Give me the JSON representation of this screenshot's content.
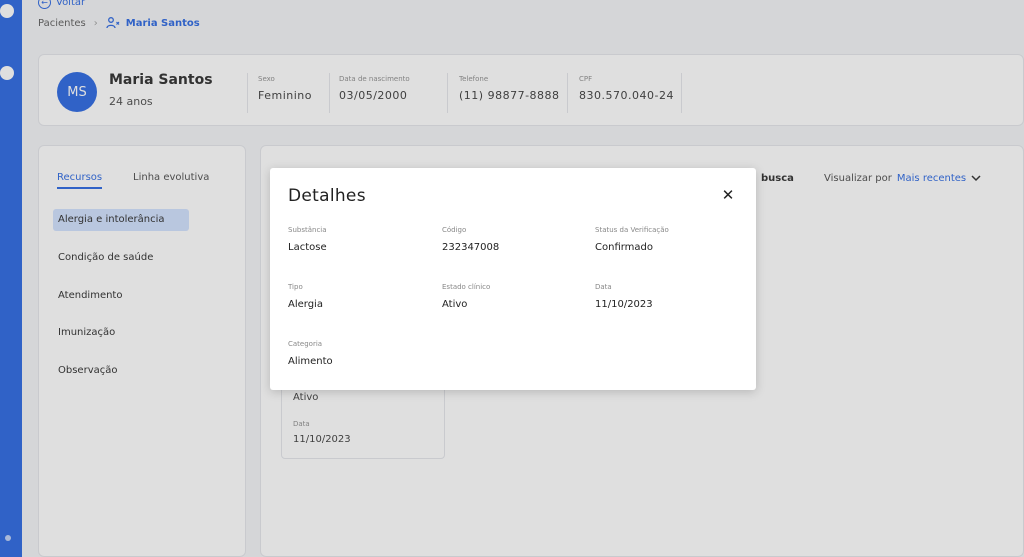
{
  "topbar": {
    "back_label": "Voltar",
    "breadcrumb_root": "Pacientes",
    "breadcrumb_sep": "›",
    "breadcrumb_current": "Maria Santos"
  },
  "patient": {
    "initials": "MS",
    "name": "Maria Santos",
    "age": "24 anos",
    "fields": [
      {
        "label": "Sexo",
        "value": "Feminino"
      },
      {
        "label": "Data de nascimento",
        "value": "03/05/2000"
      },
      {
        "label": "Telefone",
        "value": "(11) 98877-8888"
      },
      {
        "label": "CPF",
        "value": "830.570.040-24"
      }
    ]
  },
  "sidebar": {
    "tabs": [
      {
        "label": "Recursos"
      },
      {
        "label": "Linha evolutiva"
      }
    ],
    "items": [
      {
        "label": "Alergia e intolerância"
      },
      {
        "label": "Condição de saúde"
      },
      {
        "label": "Atendimento"
      },
      {
        "label": "Imunização"
      },
      {
        "label": "Observação"
      }
    ]
  },
  "main": {
    "search_hint": "busca",
    "sort_label": "Visualizar por",
    "sort_value": "Mais recentes",
    "bg_card": {
      "status_value": "Ativo",
      "date_label": "Data",
      "date_value": "11/10/2023"
    }
  },
  "modal": {
    "title": "Detalhes",
    "fields": [
      {
        "label": "Substância",
        "value": "Lactose"
      },
      {
        "label": "Código",
        "value": "232347008"
      },
      {
        "label": "Status da Verificação",
        "value": "Confirmado"
      },
      {
        "label": "Tipo",
        "value": "Alergia"
      },
      {
        "label": "Estado clínico",
        "value": "Ativo"
      },
      {
        "label": "Data",
        "value": "11/10/2023"
      },
      {
        "label": "Categoria",
        "value": "Alimento"
      }
    ]
  },
  "colors": {
    "accent": "#1f5fe0",
    "rail": "#1f5fe0",
    "active_item_bg": "#cfe0ff"
  },
  "icons": {
    "back": "arrow-left-circle-icon",
    "breadcrumb_user": "user-icon",
    "close": "close-icon",
    "sort": "chevron-down-icon"
  }
}
